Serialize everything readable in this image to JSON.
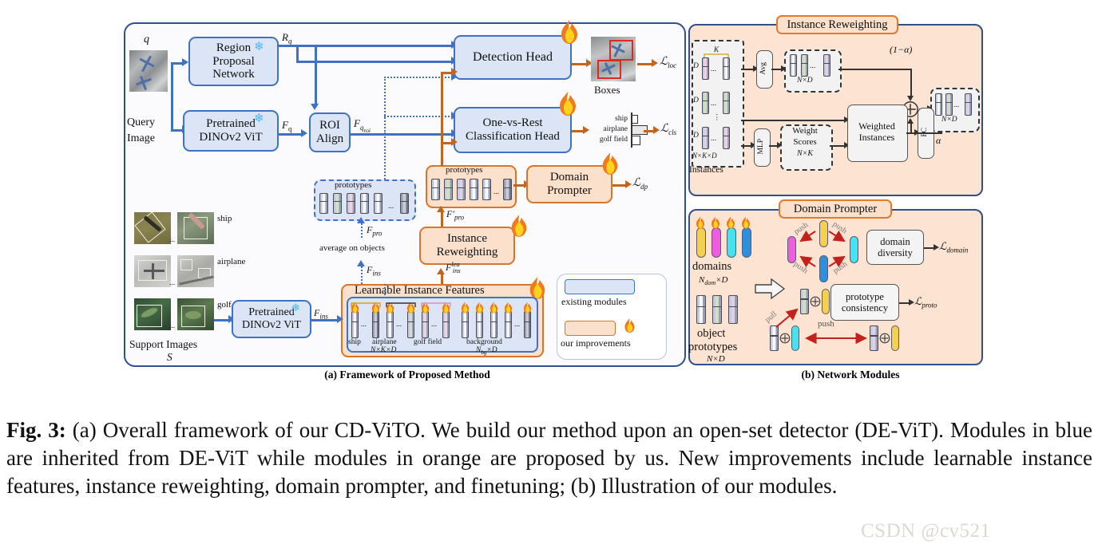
{
  "figure": {
    "label": "Fig. 3:",
    "caption": " (a) Overall framework of our CD-ViTO. We build our method upon an open-set detector (DE-ViT). Modules in blue are inherited from DE-ViT while modules in orange are proposed by us. New improvements include learnable instance features, instance reweighting, domain prompter, and finetuning; (b) Illustration of our modules.",
    "watermark": "CSDN @cv521"
  },
  "panel_a": {
    "caption": "(a) Framework of Proposed Method",
    "query": {
      "symbol": "q",
      "label_line1": "Query",
      "label_line2": "Image",
      "icon": "query-image-thumbnail"
    },
    "modules": {
      "rpn": "Region\nProposal\nNetwork",
      "rpn_l1": "Region",
      "rpn_l2": "Proposal",
      "rpn_l3": "Network",
      "backbone_q_l1": "Pretrained",
      "backbone_q_l2": "DINOv2 ViT",
      "roi_l1": "ROI",
      "roi_l2": "Align",
      "detection_head": "Detection Head",
      "cls_head_l1": "One-vs-Rest",
      "cls_head_l2": "Classification Head",
      "domain_prompter_l1": "Domain",
      "domain_prompter_l2": "Prompter",
      "instance_reweighting_l1": "Instance",
      "instance_reweighting_l2": "Reweighting",
      "learnable_instance_features": "Learnable Instance Features",
      "backbone_s_l1": "Pretrained",
      "backbone_s_l2": "DINOv2 ViT",
      "prototypes_blue": "prototypes",
      "prototypes_orange": "prototypes"
    },
    "tensors": {
      "Rq": "R",
      "Rq_sub": "q",
      "Fq": "F",
      "Fq_sub": "q",
      "Fqroi": "F",
      "Fqroi_sub": "q",
      "Fqroi_sub2": "roi",
      "Fpro": "F",
      "Fpro_sub": "pro",
      "Fpro_prime": "F",
      "Fpro_prime_sub": "pro",
      "Fins": "F",
      "Fins_sub": "ins",
      "Fins_lea": "F",
      "Fins_lea_sub": "ins",
      "Fins_lea_sup": "lea",
      "Fins_support": "F",
      "Fins_support_sub": "ins"
    },
    "losses": {
      "loc": "loc",
      "cls": "cls",
      "dp": "dp"
    },
    "outputs": {
      "boxes": "Boxes",
      "cls_rows": [
        "ship",
        "airplane",
        "golf field"
      ]
    },
    "flows": {
      "average_on_objects": "average on objects"
    },
    "support": {
      "title_l1": "Support Images",
      "title_l2": "S",
      "classes": [
        "ship",
        "airplane",
        "golf field"
      ],
      "ellipsis": "..."
    },
    "lif_labels": {
      "ship": "ship",
      "airplane": "airplane",
      "golf_field": "golf field",
      "background": "background",
      "shape_fg": "N×K×D",
      "shape_bg_main": "N",
      "shape_bg_sub": "bg",
      "shape_bg_tail": "×D",
      "ellipsis": "..."
    },
    "legend": {
      "existing": "existing modules",
      "ours": "our improvements",
      "flame_icon": "flame-icon"
    }
  },
  "panel_b": {
    "caption": "(b) Network Modules",
    "instance_reweighting": {
      "title": "Instance Reweighting",
      "instances_label": "Instances",
      "K": "K",
      "D": "D",
      "shape_instances": "N×K×D",
      "avg": "Avg",
      "shape_avg_out": "N×D",
      "mlp": "MLP",
      "weight_scores_l1": "Weight",
      "weight_scores_l2": "Scores",
      "weight_scores_shape": "N×K",
      "weighted_instances_l1": "Weighted",
      "weighted_instances_l2": "Instances",
      "fc": "FC",
      "alpha": "α",
      "one_minus_alpha": "(1−α)",
      "plus_icon": "circle-plus-icon",
      "shape_output": "N×D",
      "ellipsis": "..."
    },
    "domain_prompter": {
      "title": "Domain Prompter",
      "domains_label": "domains",
      "domains_shape_main": "N",
      "domains_shape_sub": "dom",
      "domains_shape_tail": "×D",
      "object_prototypes_l1": "object",
      "object_prototypes_l2": "prototypes",
      "object_shape": "N×D",
      "push": "push",
      "pull": "pull",
      "domain_diversity_l1": "domain",
      "domain_diversity_l2": "diversity",
      "prototype_consistency_l1": "prototype",
      "prototype_consistency_l2": "consistency",
      "loss_domain": "domain",
      "loss_proto": "proto",
      "arrow_icon": "block-arrow-right-icon",
      "plus_icon": "circle-plus-icon"
    }
  },
  "colors": {
    "blue_fill": "#dce5f5",
    "blue_stroke": "#3f72c4",
    "orange_fill": "#fbe0cb",
    "orange_stroke": "#d9742b",
    "panel_stroke": "#2f4f8f",
    "panel_b_fill": "#fce3d2",
    "red_arrow": "#c4201c",
    "detection_box": "#e02822"
  }
}
